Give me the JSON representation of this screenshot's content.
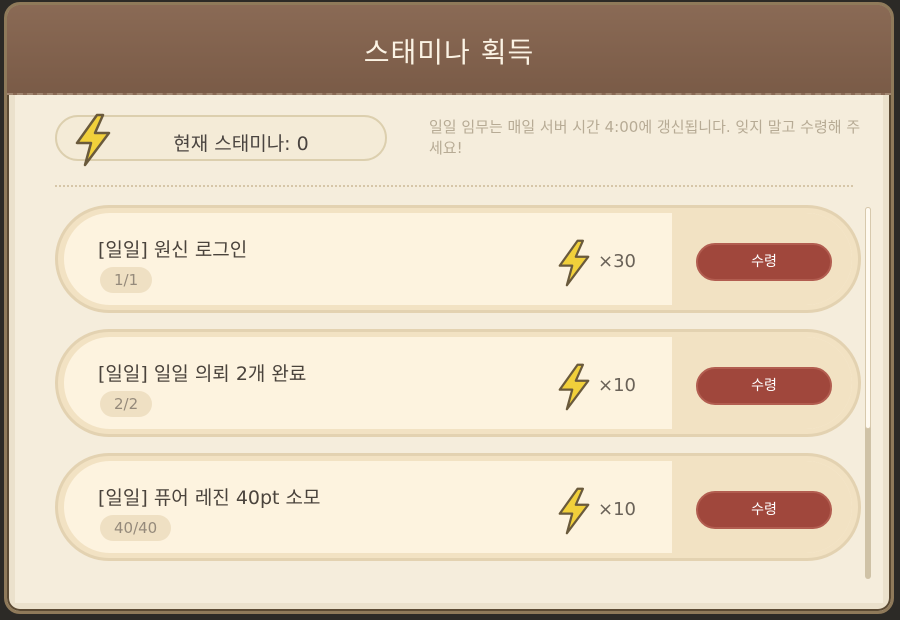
{
  "dialog": {
    "title": "스태미나 획득",
    "stamina_label": "현재 스태미나: 0",
    "notice": "일일 임무는 매일 서버 시간 4:00에 갱신됩니다. 잊지 말고 수령해 주세요!"
  },
  "tasks": [
    {
      "title": "[일일] 원신 로그인",
      "progress": "1/1",
      "reward": "×30",
      "button": "수령"
    },
    {
      "title": "[일일] 일일 의뢰 2개 완료",
      "progress": "2/2",
      "reward": "×10",
      "button": "수령"
    },
    {
      "title": "[일일] 퓨어 레진 40pt 소모",
      "progress": "40/40",
      "reward": "×10",
      "button": "수령"
    }
  ],
  "icons": {
    "stamina": "lightning-bolt-icon",
    "reward": "lightning-bolt-icon"
  },
  "colors": {
    "header": "#7a5b47",
    "claim_button": "#a0473c",
    "bolt_fill": "#f1d03b",
    "bolt_stroke": "#6a5a3c"
  }
}
